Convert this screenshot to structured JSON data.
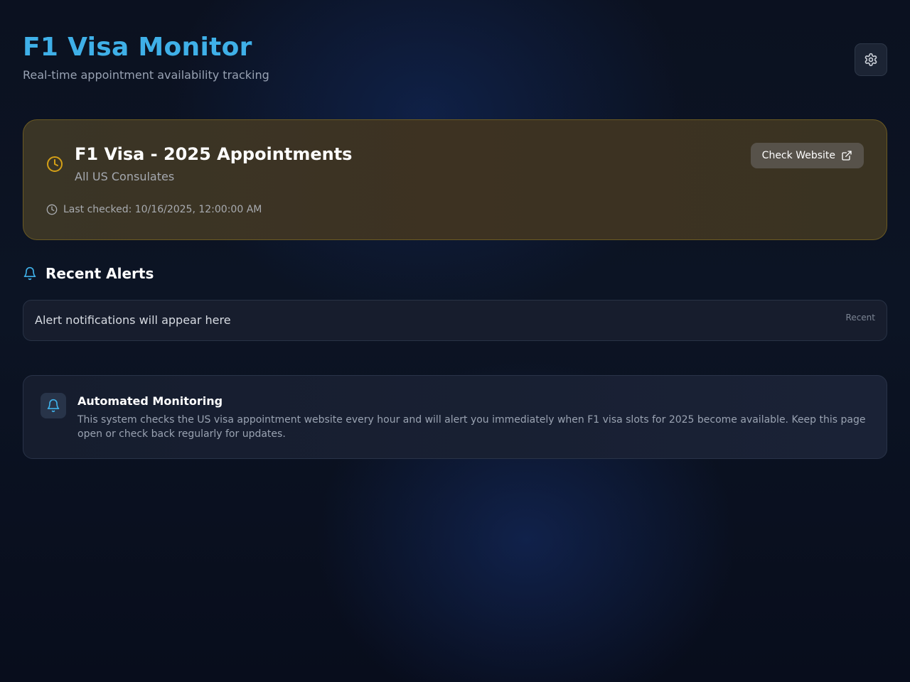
{
  "header": {
    "title": "F1 Visa Monitor",
    "subtitle": "Real-time appointment availability tracking",
    "settings_icon": "gear-icon"
  },
  "visa_card": {
    "title": "F1 Visa - 2025 Appointments",
    "subtitle": "All US Consulates",
    "check_button_label": "Check Website",
    "last_checked": "Last checked: 10/16/2025, 12:00:00 AM",
    "status_icon": "clock-icon",
    "accent_color": "#d4a017"
  },
  "alerts": {
    "heading": "Recent Alerts",
    "heading_icon": "bell-icon",
    "items": [
      {
        "text": "Alert notifications will appear here",
        "time": "Recent"
      }
    ]
  },
  "info": {
    "title": "Automated Monitoring",
    "text": "This system checks the US visa appointment website every hour and will alert you immediately when F1 visa slots for 2025 become available. Keep this page open or check back regularly for updates.",
    "icon": "bell-icon"
  },
  "colors": {
    "brand": "#3fb0e8",
    "background": "#0b1120"
  }
}
